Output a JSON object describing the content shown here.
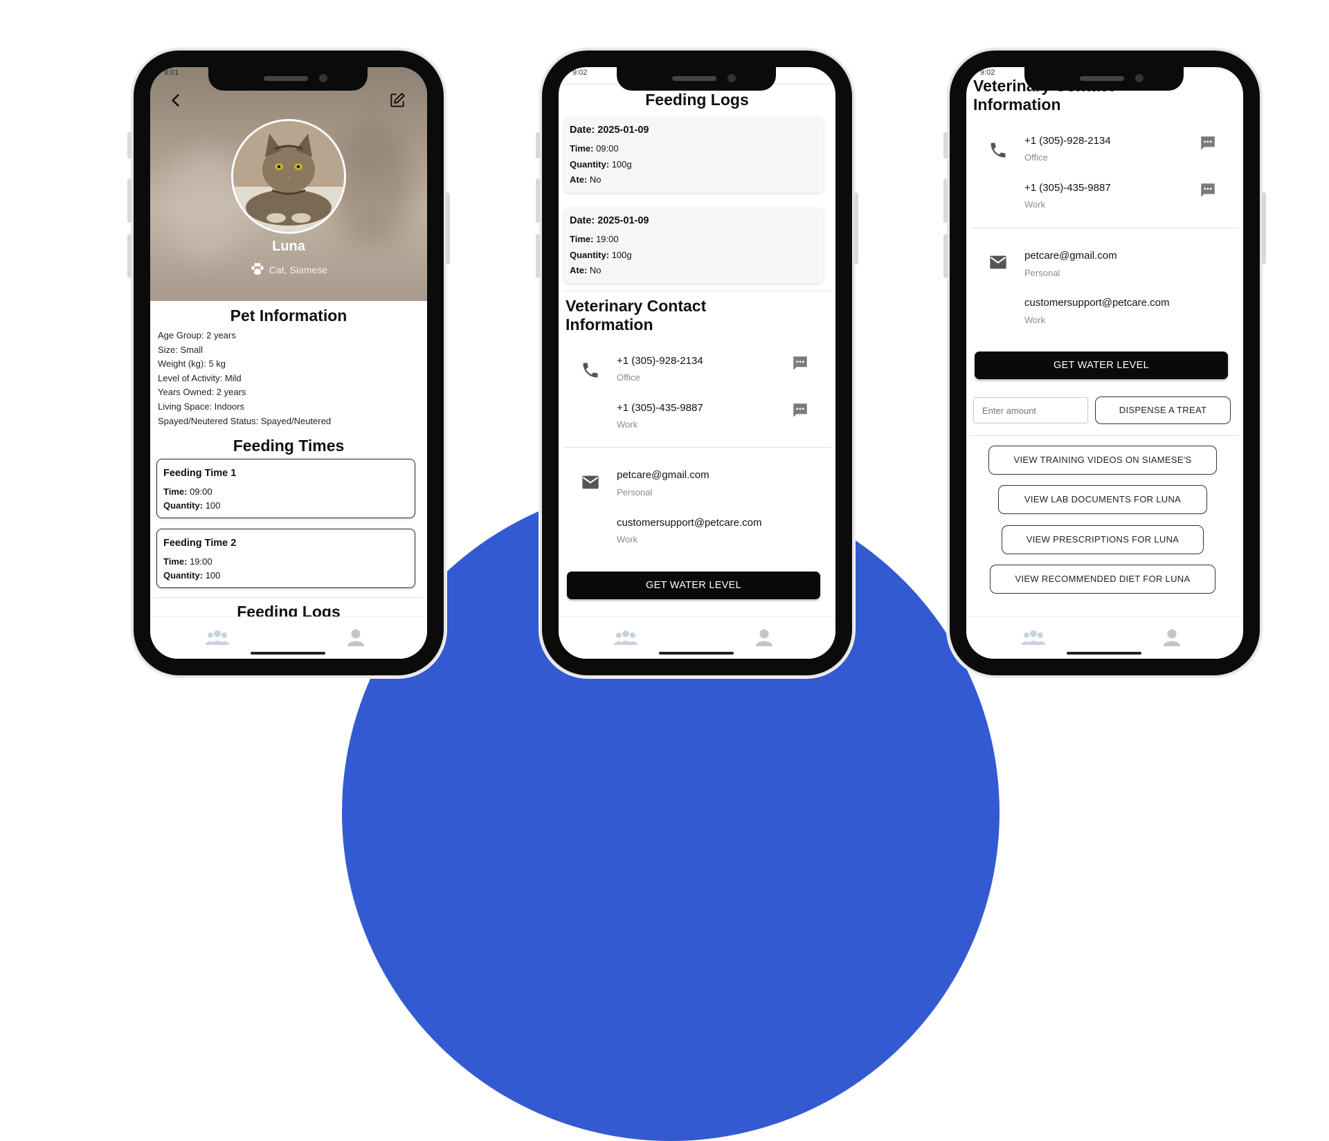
{
  "brand_colors": {
    "accent_blue": "#335ad0",
    "button_black": "#0a0a0a"
  },
  "phone1": {
    "status_time": "9:01",
    "header": {
      "back_icon": "chevron-left-icon",
      "edit_icon": "edit-icon"
    },
    "pet": {
      "name": "Luna",
      "breed": "Cat, Siamese",
      "breed_icon": "paw-icon"
    },
    "pet_info": {
      "title": "Pet Information",
      "lines": [
        "Age Group: 2 years",
        "Size: Small",
        "Weight (kg): 5 kg",
        "Level of Activity: Mild",
        "Years Owned: 2 years",
        "Living Space: Indoors",
        "Spayed/Neutered Status: Spayed/Neutered"
      ]
    },
    "feeding_times": {
      "title": "Feeding Times",
      "time_label": "Time:",
      "quantity_label": "Quantity:",
      "items": [
        {
          "title": "Feeding Time 1",
          "time": "09:00",
          "quantity": "100"
        },
        {
          "title": "Feeding Time 2",
          "time": "19:00",
          "quantity": "100"
        }
      ]
    },
    "next_section_peek": "Feeding Logs"
  },
  "phone2": {
    "status_time": "9:02",
    "feeding_logs": {
      "title": "Feeding Logs",
      "date_label": "Date:",
      "time_label": "Time:",
      "quantity_label": "Quantity:",
      "ate_label": "Ate:",
      "items": [
        {
          "date": "2025-01-09",
          "time": "09:00",
          "quantity": "100g",
          "ate": "No"
        },
        {
          "date": "2025-01-09",
          "time": "19:00",
          "quantity": "100g",
          "ate": "No"
        }
      ]
    }
  },
  "phone3": {
    "status_time": "9:02",
    "treat": {
      "amount_placeholder": "Enter amount",
      "dispense_label": "DISPENSE A TREAT"
    },
    "links": [
      "VIEW TRAINING VIDEOS ON SIAMESE'S",
      "VIEW LAB DOCUMENTS FOR LUNA",
      "VIEW PRESCRIPTIONS FOR LUNA",
      "VIEW RECOMMENDED DIET FOR LUNA"
    ]
  },
  "vet_contact": {
    "title_line1": "Veterinary Contact",
    "title_line2": "Information",
    "phones": [
      {
        "number": "+1 (305)-928-2134",
        "type": "Office"
      },
      {
        "number": "+1 (305)-435-9887",
        "type": "Work"
      }
    ],
    "emails": [
      {
        "address": "petcare@gmail.com",
        "type": "Personal"
      },
      {
        "address": "customersupport@petcare.com",
        "type": "Work"
      }
    ],
    "phone_icon": "phone-icon",
    "email_icon": "mail-icon",
    "message_icon": "message-icon"
  },
  "water_button_label": "GET WATER LEVEL",
  "bottom_nav": {
    "left_icon": "group-icon",
    "right_icon": "profile-icon"
  }
}
